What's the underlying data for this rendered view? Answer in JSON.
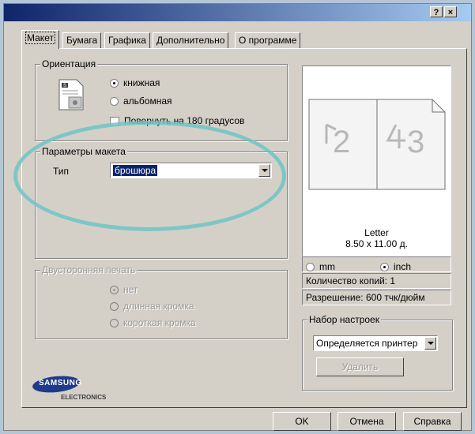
{
  "window": {
    "help_label": "?",
    "close_label": "×"
  },
  "tabs": [
    {
      "label": "Макет"
    },
    {
      "label": "Бумага"
    },
    {
      "label": "Графика"
    },
    {
      "label": "Дополнительно"
    },
    {
      "label": "О программе"
    }
  ],
  "orientation": {
    "legend": "Ориентация",
    "portrait": "книжная",
    "landscape": "альбомная",
    "rotate": "Повернуть на 180 градусов"
  },
  "layout": {
    "legend": "Параметры макета",
    "type_label": "Тип",
    "type_value": "брошюра"
  },
  "duplex": {
    "legend": "Двусторонняя печать",
    "none": "нет",
    "long": "длинная кромка",
    "short": "короткая кромка"
  },
  "preview": {
    "page_left": "2",
    "page_right": "3",
    "paper_name": "Letter",
    "paper_size": "8.50 x 11.00 д."
  },
  "units": {
    "mm": "mm",
    "inch": "inch"
  },
  "copies": "Количество копий: 1",
  "resolution": "Разрешение: 600 тчк/дюйм",
  "favorites": {
    "legend": "Набор настроек",
    "value": "Определяется принтер",
    "delete_label": "Удалить"
  },
  "logo": {
    "brand": "SAMSUNG",
    "sub": "ELECTRONICS"
  },
  "buttons": {
    "ok": "OK",
    "cancel": "Отмена",
    "help": "Справка"
  },
  "colors": {
    "highlight_ellipse": "#6fc4c6",
    "title_bar": "#10246a"
  }
}
